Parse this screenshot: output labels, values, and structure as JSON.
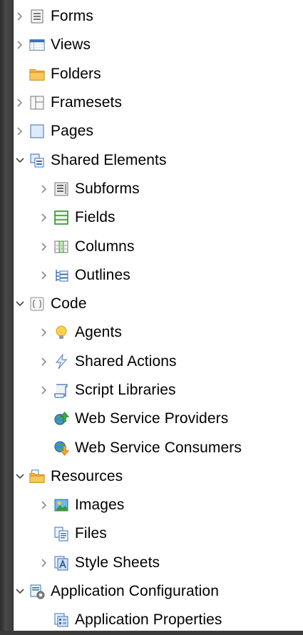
{
  "tree": {
    "forms": "Forms",
    "views": "Views",
    "folders": "Folders",
    "framesets": "Framesets",
    "pages": "Pages",
    "shared_elements": "Shared Elements",
    "subforms": "Subforms",
    "fields": "Fields",
    "columns": "Columns",
    "outlines": "Outlines",
    "code": "Code",
    "agents": "Agents",
    "shared_actions": "Shared Actions",
    "script_libraries": "Script Libraries",
    "web_service_providers": "Web Service Providers",
    "web_service_consumers": "Web Service Consumers",
    "resources": "Resources",
    "images": "Images",
    "files": "Files",
    "style_sheets": "Style Sheets",
    "application_configuration": "Application Configuration",
    "application_properties": "Application Properties"
  },
  "colors": {
    "twisty": "#8a8a8a",
    "folder": "#f4b63f",
    "icon_blue": "#3b6fb6",
    "icon_green": "#3a9a3a"
  }
}
